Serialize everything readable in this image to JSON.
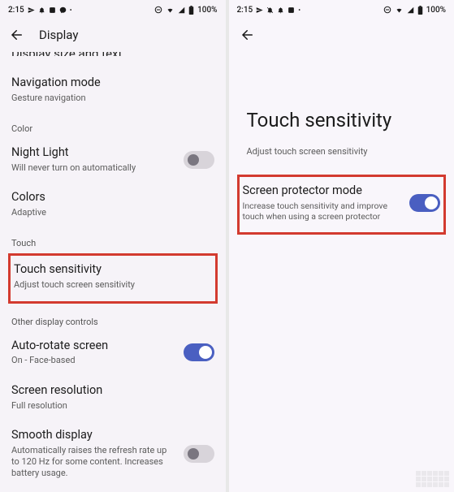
{
  "status": {
    "time": "2:15",
    "battery": "100%"
  },
  "left": {
    "app_bar_title": "Display",
    "truncated_row": "Display size and text",
    "nav_mode": {
      "title": "Navigation mode",
      "sub": "Gesture navigation"
    },
    "section_color": "Color",
    "night_light": {
      "title": "Night Light",
      "sub": "Will never turn on automatically"
    },
    "colors": {
      "title": "Colors",
      "sub": "Adaptive"
    },
    "section_touch": "Touch",
    "touch_sens": {
      "title": "Touch sensitivity",
      "sub": "Adjust touch screen sensitivity"
    },
    "section_other": "Other display controls",
    "auto_rotate": {
      "title": "Auto-rotate screen",
      "sub": "On - Face-based"
    },
    "screen_res": {
      "title": "Screen resolution",
      "sub": "Full resolution"
    },
    "smooth": {
      "title": "Smooth display",
      "sub": "Automatically raises the refresh rate up to 120 Hz for some content. Increases battery usage."
    }
  },
  "right": {
    "page_title": "Touch sensitivity",
    "page_sub": "Adjust touch screen sensitivity",
    "protector": {
      "title": "Screen protector mode",
      "sub": "Increase touch sensitivity and improve touch when using a screen protector"
    }
  }
}
